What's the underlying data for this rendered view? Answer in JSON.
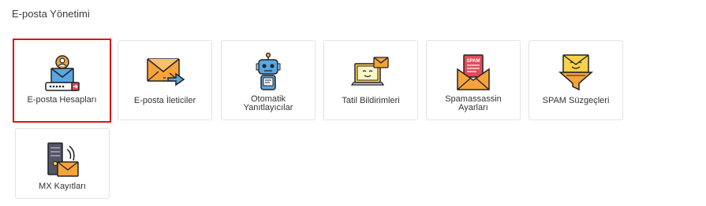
{
  "section": {
    "title": "E-posta Yönetimi"
  },
  "tiles": [
    {
      "label": "E-posta Hesapları",
      "icon": "email-accounts-icon",
      "selected": true
    },
    {
      "label": "E-posta İleticiler",
      "icon": "email-forwarders-icon"
    },
    {
      "label_line1": "Otomatik",
      "label_line2": "Yanıtlayıcılar",
      "icon": "robot-autoresponder-icon"
    },
    {
      "label": "Tatil Bildirimleri",
      "icon": "vacation-notice-icon"
    },
    {
      "label_line1": "Spamassassin",
      "label_line2": "Ayarları",
      "icon": "spam-envelope-icon",
      "icon_text": "SPAM"
    },
    {
      "label": "SPAM Süzgeçleri",
      "icon": "spam-filter-icon"
    },
    {
      "label": "MX Kayıtları",
      "icon": "mx-server-icon"
    }
  ],
  "colors": {
    "selected_border": "#e01212",
    "tile_border": "#e3e3e3",
    "accent_orange": "#f7a33a",
    "accent_yellow": "#f9d24a",
    "accent_blue": "#5aa6e0"
  }
}
